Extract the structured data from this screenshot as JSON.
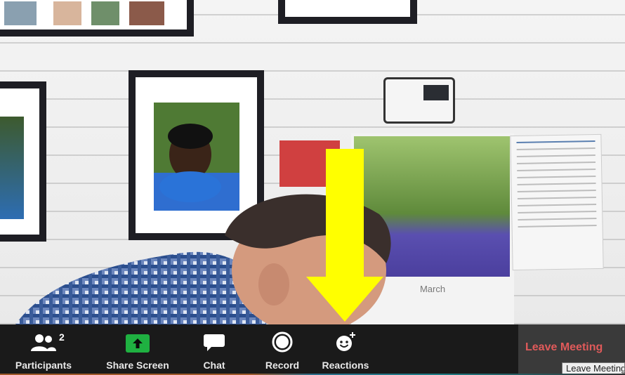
{
  "toolbar": {
    "participants": {
      "label": "Participants",
      "count": "2",
      "icon": "participants-icon"
    },
    "share_screen": {
      "label": "Share Screen",
      "icon": "share-screen-icon",
      "accent": "#1fb141"
    },
    "chat": {
      "label": "Chat",
      "icon": "chat-icon"
    },
    "record": {
      "label": "Record",
      "icon": "record-icon"
    },
    "reactions": {
      "label": "Reactions",
      "icon": "reactions-icon"
    },
    "leave": {
      "label": "Leave Meeting",
      "color": "#e05a5a"
    }
  },
  "tooltip": {
    "text": "Leave Meeting"
  },
  "scene": {
    "calendar_month": "March",
    "arrow_color": "#ffff00"
  }
}
